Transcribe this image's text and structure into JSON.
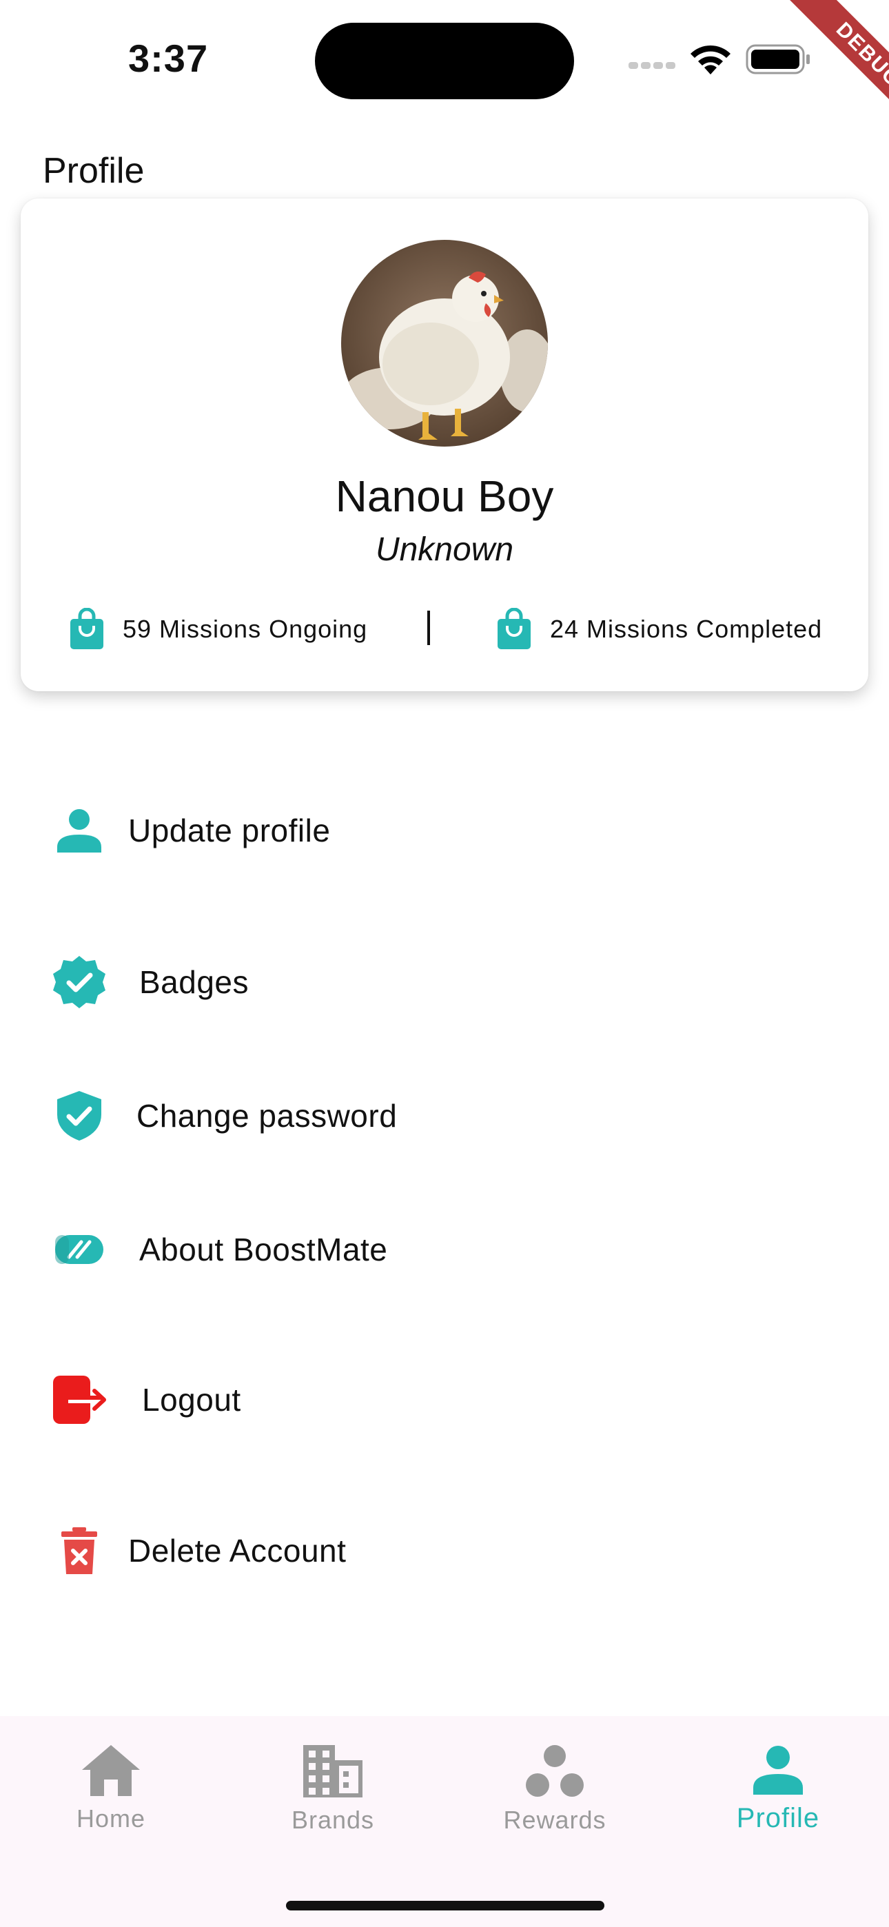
{
  "status_bar": {
    "time": "3:37",
    "debug_label": "DEBUG"
  },
  "header": {
    "title": "Profile"
  },
  "profile": {
    "name": "Nanou Boy",
    "role": "Unknown",
    "missions_ongoing": "59 Missions Ongoing",
    "missions_completed": "24 Missions Completed",
    "avatar_icon": "chicken-photo"
  },
  "menu": {
    "items": [
      {
        "label": "Update profile",
        "icon": "person-icon"
      },
      {
        "label": "Badges",
        "icon": "verified-badge-icon"
      },
      {
        "label": "Change password",
        "icon": "shield-check-icon"
      },
      {
        "label": "About BoostMate",
        "icon": "boostmate-logo-icon"
      },
      {
        "label": "Logout",
        "icon": "logout-icon"
      },
      {
        "label": "Delete Account",
        "icon": "trash-icon"
      }
    ]
  },
  "bottom_nav": {
    "items": [
      {
        "label": "Home",
        "icon": "home-icon"
      },
      {
        "label": "Brands",
        "icon": "building-icon"
      },
      {
        "label": "Rewards",
        "icon": "rewards-icon"
      },
      {
        "label": "Profile",
        "icon": "person-icon"
      }
    ],
    "active": "Profile"
  },
  "colors": {
    "accent": "#26b8b4",
    "danger": "#ea1c1c",
    "delete": "#e54a47",
    "inactive": "#9a9a9a",
    "nav_bg": "#fdf6fb"
  }
}
